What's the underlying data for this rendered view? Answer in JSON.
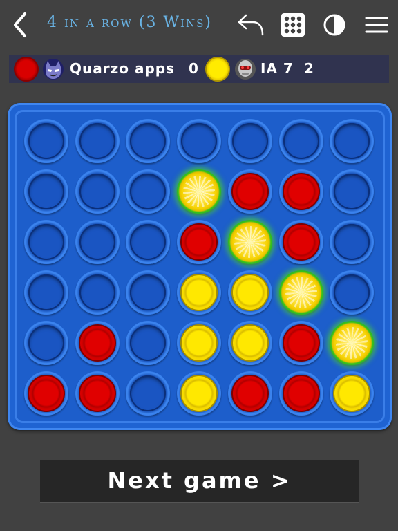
{
  "header": {
    "title": "4 in a row (3 Wins)",
    "icons": [
      "back-arrow-icon",
      "undo-icon",
      "grid-icon",
      "contrast-icon",
      "menu-icon"
    ]
  },
  "score": {
    "player1": {
      "disc": "red",
      "avatar": "masked-hero-icon",
      "name": "Quarzo apps",
      "wins": "0"
    },
    "player2": {
      "disc": "yellow",
      "avatar": "robot-icon",
      "name": "IA 7",
      "wins": "2"
    }
  },
  "board": {
    "rows": 6,
    "cols": 7,
    "cells": [
      [
        "",
        "",
        "",
        "",
        "",
        "",
        ""
      ],
      [
        "",
        "",
        "",
        "Y",
        "R",
        "R",
        ""
      ],
      [
        "",
        "",
        "",
        "R",
        "Y",
        "R",
        ""
      ],
      [
        "",
        "",
        "",
        "Y",
        "Y",
        "Y",
        ""
      ],
      [
        "",
        "R",
        "",
        "Y",
        "Y",
        "R",
        "Y"
      ],
      [
        "R",
        "R",
        "",
        "Y",
        "R",
        "R",
        "Y"
      ]
    ],
    "winning": [
      [
        1,
        3
      ],
      [
        2,
        4
      ],
      [
        3,
        5
      ],
      [
        4,
        6
      ]
    ]
  },
  "actions": {
    "next_label": "Next game >"
  },
  "colors": {
    "background": "#414141",
    "board": "#1f63d2",
    "title": "#69b3e4",
    "red": "#d90000",
    "yellow": "#ffe800",
    "win_glow": "#2ebd1a"
  }
}
